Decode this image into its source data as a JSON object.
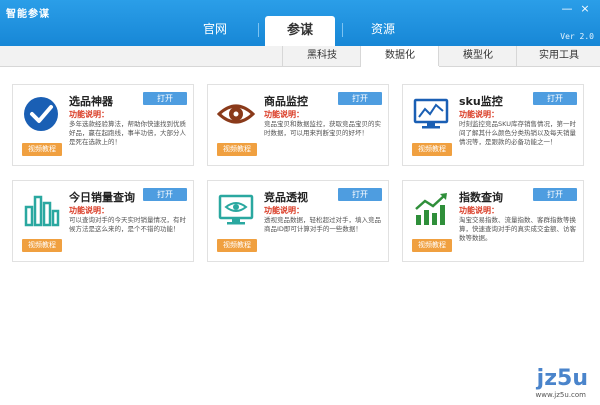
{
  "window": {
    "title": "智能参谋",
    "version": "Ver 2.0",
    "minimize": "—",
    "close": "×"
  },
  "main_nav": [
    {
      "label": "官网",
      "active": false
    },
    {
      "label": "参谋",
      "active": true
    },
    {
      "label": "资源",
      "active": false
    }
  ],
  "sub_nav": [
    {
      "label": "黑科技",
      "active": false
    },
    {
      "label": "数据化",
      "active": true
    },
    {
      "label": "模型化",
      "active": false
    },
    {
      "label": "实用工具",
      "active": false
    }
  ],
  "common": {
    "open_label": "打开",
    "function_label": "功能说明：",
    "tutorial_label": "视频教程"
  },
  "cards": [
    {
      "title": "选品神器",
      "icon": "checkmark-circle-icon",
      "desc": "多年选款经验算法，帮助你快速找到优质好品，赢在起跑线，事半功倍，大部分人是死在选款上的！"
    },
    {
      "title": "商品监控",
      "icon": "eye-icon",
      "desc": "竞品宝贝和数据监控，获取竞品宝贝的实时数据，可以用来判断宝贝的好坏！"
    },
    {
      "title": "sku监控",
      "icon": "monitor-chart-icon",
      "desc": "时刻监控竞品SKU库存销售情况，第一时间了解其什么颜色分类热销以及每天销量情况等，是跟款的必备功能之一！"
    },
    {
      "title": "今日销量查询",
      "icon": "bar-chart-icon",
      "desc": "可以查询对手的今天实时销量情况，有时候方法是这么来的，是个不错的功能！"
    },
    {
      "title": "竞品透视",
      "icon": "monitor-eye-icon",
      "desc": "透视竞品数据，轻松超过对手，填入竞品商品ID即可计算对手的一些数据！"
    },
    {
      "title": "指数查询",
      "icon": "growth-chart-icon",
      "desc": "淘宝交易指数、流量指数、客群指数等换算，快速查询对手的真实成交金额、访客数等数据。"
    }
  ],
  "watermark": {
    "logo": "jz5u",
    "site": "www.jz5u.com"
  },
  "colors": {
    "topbar": "#1787d6",
    "open_button": "#4e9de0",
    "tutorial_button": "#f0a040",
    "function_label": "#d9361f",
    "icon_blue": "#1a5fb4",
    "icon_brown": "#8a3a1a",
    "icon_teal": "#2aa8a0",
    "icon_green": "#2f8f3a"
  }
}
